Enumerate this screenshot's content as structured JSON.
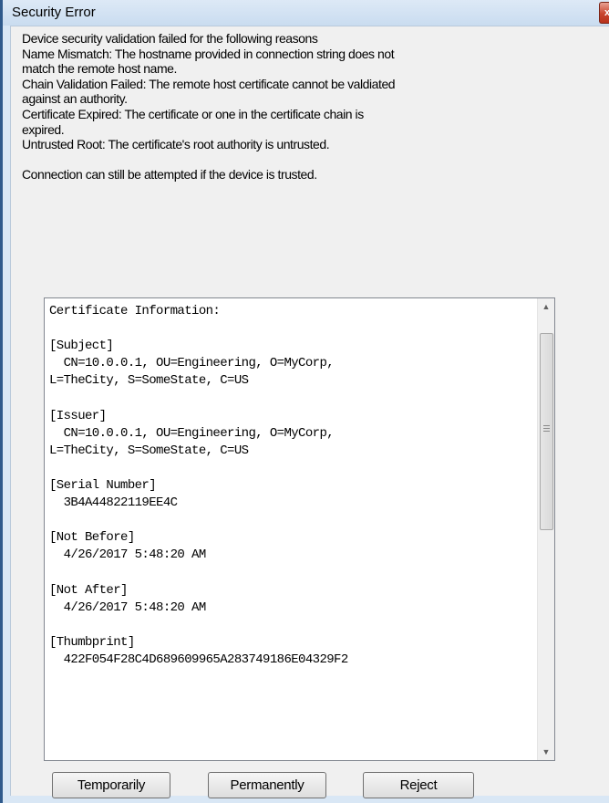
{
  "window": {
    "title": "Security Error",
    "close_label": "x"
  },
  "message": {
    "lines": [
      "Device security validation failed for the following reasons",
      "Name Mismatch: The hostname provided in connection string does not",
      "match the remote host name.",
      "Chain Validation Failed: The remote host certificate cannot be valdiated",
      "against an authority.",
      "Certificate Expired: The certificate or one in the certificate chain is",
      "expired.",
      "Untrusted Root: The certificate's root authority is untrusted.",
      "",
      "Connection can still be attempted if the device is trusted."
    ]
  },
  "certificate": {
    "text": "Certificate Information:\n\n[Subject]\n  CN=10.0.0.1, OU=Engineering, O=MyCorp,\nL=TheCity, S=SomeState, C=US\n\n[Issuer]\n  CN=10.0.0.1, OU=Engineering, O=MyCorp,\nL=TheCity, S=SomeState, C=US\n\n[Serial Number]\n  3B4A44822119EE4C\n\n[Not Before]\n  4/26/2017 5:48:20 AM\n\n[Not After]\n  4/26/2017 5:48:20 AM\n\n[Thumbprint]\n  422F054F28C4D689609965A283749186E04329F2",
    "scroll_up_icon": "▲",
    "scroll_down_icon": "▼"
  },
  "buttons": {
    "temporarily": "Temporarily",
    "permanently": "Permanently",
    "reject": "Reject"
  }
}
